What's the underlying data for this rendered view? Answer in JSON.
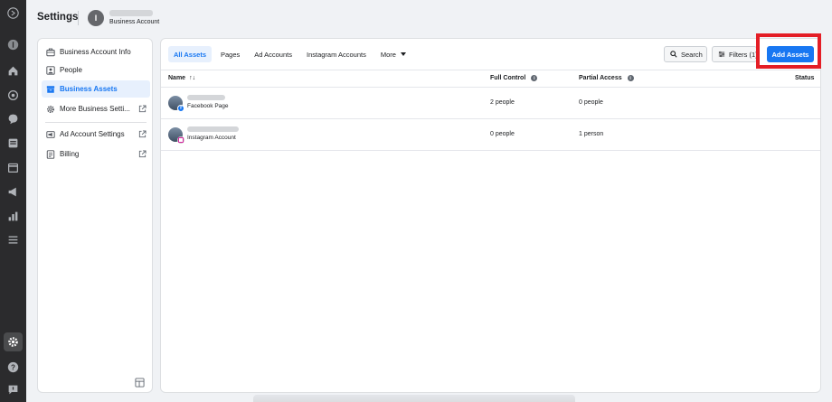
{
  "header": {
    "title": "Settings",
    "account_initial": "I",
    "account_type": "Business Account"
  },
  "rail": {
    "icons": [
      "logo-icon",
      "profile-icon",
      "home-icon",
      "activity-icon",
      "chat-icon",
      "pages-icon",
      "calendar-icon",
      "ads-icon",
      "insights-icon",
      "menu-icon",
      "settings-icon",
      "help-icon",
      "feedback-icon"
    ]
  },
  "sidebar": {
    "items": [
      {
        "label": "Business Account Info",
        "icon": "briefcase-icon",
        "external": false,
        "active": false
      },
      {
        "label": "People",
        "icon": "person-icon",
        "external": false,
        "active": false
      },
      {
        "label": "Business Assets",
        "icon": "assets-icon",
        "external": false,
        "active": true
      },
      {
        "label": "More Business Setti...",
        "icon": "gear-icon",
        "external": true,
        "active": false
      },
      {
        "label": "Ad Account Settings",
        "icon": "ad-account-icon",
        "external": true,
        "active": false
      },
      {
        "label": "Billing",
        "icon": "billing-icon",
        "external": true,
        "active": false
      }
    ]
  },
  "tabs": [
    {
      "label": "All Assets",
      "active": true
    },
    {
      "label": "Pages",
      "active": false
    },
    {
      "label": "Ad Accounts",
      "active": false
    },
    {
      "label": "Instagram Accounts",
      "active": false
    },
    {
      "label": "More",
      "active": false
    }
  ],
  "toolbar": {
    "search_label": "Search",
    "filters_label": "Filters (1)",
    "add_label": "Add Assets"
  },
  "table": {
    "headers": {
      "name": "Name",
      "sort": "↑↓",
      "full_control": "Full Control",
      "partial_access": "Partial Access",
      "status": "Status"
    },
    "rows": [
      {
        "type": "Facebook Page",
        "full_control": "2 people",
        "partial_access": "0 people"
      },
      {
        "type": "Instagram Account",
        "full_control": "0 people",
        "partial_access": "1 person"
      }
    ]
  },
  "colors": {
    "accent": "#1877f2",
    "highlight": "#e41e26",
    "rail": "#2b2b2d"
  }
}
